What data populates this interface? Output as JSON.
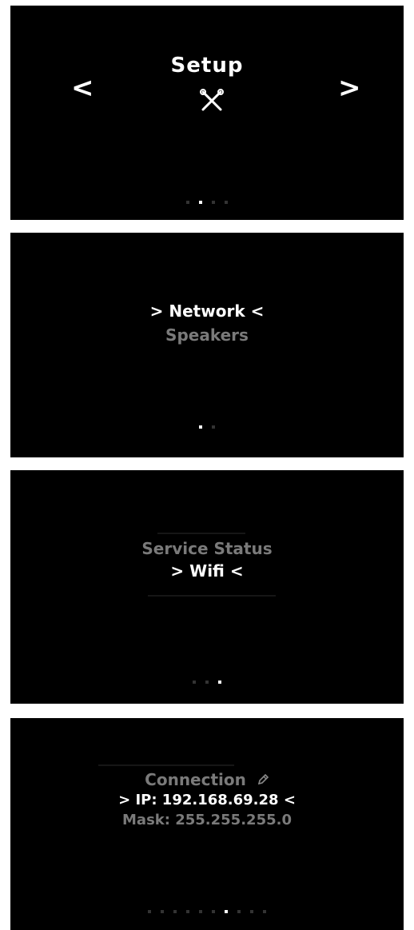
{
  "screens": [
    {
      "title": "Setup",
      "prev_icon": "chevron-left-icon",
      "next_icon": "chevron-right-icon",
      "center_icon": "tools-icon",
      "pagination": {
        "count": 4,
        "active": 1
      }
    },
    {
      "menu": {
        "selected": "> Network <",
        "next": "Speakers"
      },
      "pagination": {
        "count": 2,
        "active": 0
      }
    },
    {
      "menu": {
        "prev": "Service Status",
        "selected": "> Wifi <"
      },
      "pagination": {
        "count": 3,
        "active": 2
      }
    },
    {
      "menu": {
        "prev": "Connection",
        "prev_icon": "pencil-icon",
        "selected": "> IP: 192.168.69.28 <",
        "next": "Mask: 255.255.255.0"
      },
      "pagination": {
        "count": 10,
        "active": 6
      }
    }
  ],
  "colors": {
    "background": "#000000",
    "selected_text": "#ffffff",
    "unselected_text": "#7a7a7a",
    "inactive_dot": "#333333",
    "active_dot": "#ffffff"
  }
}
